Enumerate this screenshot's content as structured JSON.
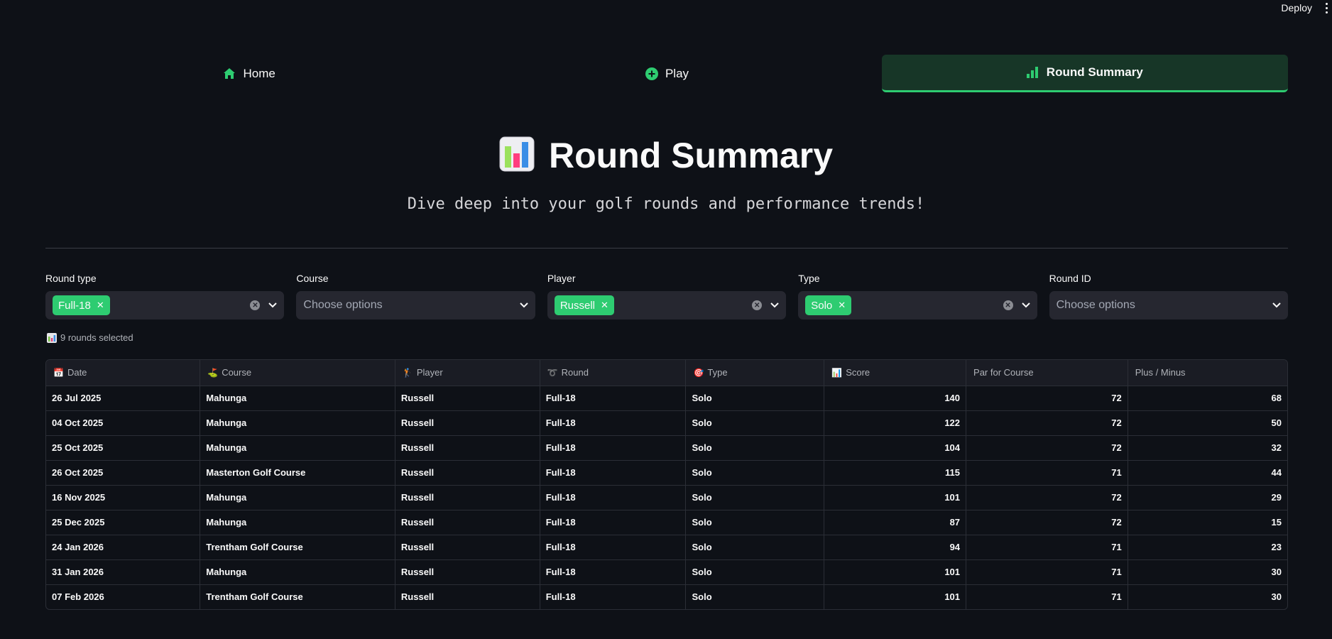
{
  "topbar": {
    "deploy_label": "Deploy"
  },
  "nav": {
    "home_label": "Home",
    "play_label": "Play",
    "summary_label": "Round Summary"
  },
  "page": {
    "title": "Round Summary",
    "subtitle": "Dive deep into your golf rounds and performance trends!"
  },
  "filters": {
    "round_type": {
      "label": "Round type",
      "chip": "Full-18"
    },
    "course": {
      "label": "Course",
      "placeholder": "Choose options"
    },
    "player": {
      "label": "Player",
      "chip": "Russell"
    },
    "type": {
      "label": "Type",
      "chip": "Solo"
    },
    "round_id": {
      "label": "Round ID",
      "placeholder": "Choose options"
    }
  },
  "count_text": "9 rounds selected",
  "table": {
    "headers": [
      "Date",
      "Course",
      "Player",
      "Round",
      "Type",
      "Score",
      "Par for Course",
      "Plus / Minus"
    ],
    "rows": [
      [
        "26 Jul 2025",
        "Mahunga",
        "Russell",
        "Full-18",
        "Solo",
        "140",
        "72",
        "68"
      ],
      [
        "04 Oct 2025",
        "Mahunga",
        "Russell",
        "Full-18",
        "Solo",
        "122",
        "72",
        "50"
      ],
      [
        "25 Oct 2025",
        "Mahunga",
        "Russell",
        "Full-18",
        "Solo",
        "104",
        "72",
        "32"
      ],
      [
        "26 Oct 2025",
        "Masterton Golf Course",
        "Russell",
        "Full-18",
        "Solo",
        "115",
        "71",
        "44"
      ],
      [
        "16 Nov 2025",
        "Mahunga",
        "Russell",
        "Full-18",
        "Solo",
        "101",
        "72",
        "29"
      ],
      [
        "25 Dec 2025",
        "Mahunga",
        "Russell",
        "Full-18",
        "Solo",
        "87",
        "72",
        "15"
      ],
      [
        "24 Jan 2026",
        "Trentham Golf Course",
        "Russell",
        "Full-18",
        "Solo",
        "94",
        "71",
        "23"
      ],
      [
        "31 Jan 2026",
        "Mahunga",
        "Russell",
        "Full-18",
        "Solo",
        "101",
        "71",
        "30"
      ],
      [
        "07 Feb 2026",
        "Trentham Golf Course",
        "Russell",
        "Full-18",
        "Solo",
        "101",
        "71",
        "30"
      ]
    ]
  },
  "colors": {
    "accent": "#2ecc71",
    "background": "#0e1117",
    "active_tab": "#173627"
  }
}
